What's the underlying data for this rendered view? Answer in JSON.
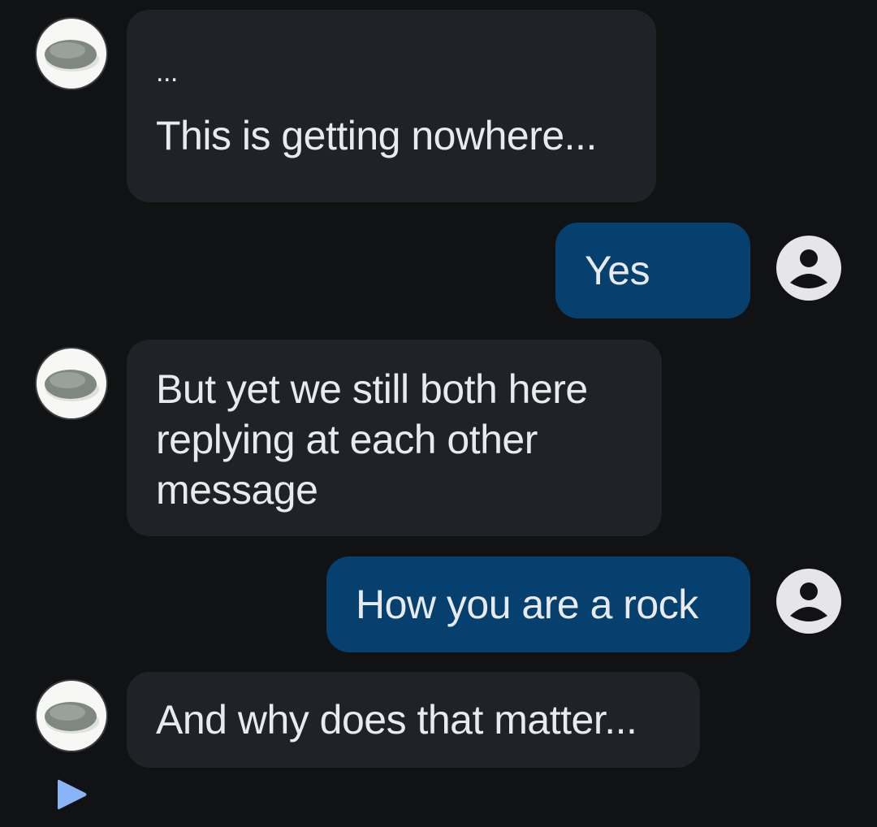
{
  "messages": [
    {
      "side": "incoming",
      "sender": "rock",
      "lines": [
        "...",
        "",
        "This is getting nowhere..."
      ]
    },
    {
      "side": "outgoing",
      "sender": "user",
      "lines": [
        "Yes"
      ]
    },
    {
      "side": "incoming",
      "sender": "rock",
      "lines": [
        "But yet we still both here",
        "replying at each other",
        "message"
      ]
    },
    {
      "side": "outgoing",
      "sender": "user",
      "lines": [
        "How you are a rock"
      ]
    },
    {
      "side": "incoming",
      "sender": "rock",
      "lines": [
        "And why does that matter..."
      ]
    }
  ],
  "icons": {
    "rock_avatar": "rock-avatar",
    "user_avatar": "user-avatar-icon",
    "play": "play-icon"
  },
  "colors": {
    "background": "#111214",
    "incoming_bubble": "#202227",
    "outgoing_bubble": "#05406e",
    "text": "#e9eaee",
    "play_icon": "#8ab4f8"
  }
}
